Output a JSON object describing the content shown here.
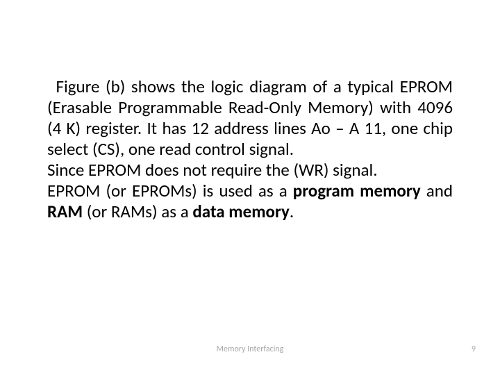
{
  "body": {
    "p1": " Figure (b) shows the logic diagram of a typical EPROM (Erasable Programmable Read-Only Memory) with 4096 (4 K) register. It has 12 address lines Ao – A 11, one chip select (CS), one read control signal.",
    "p2": "Since EPROM does not require the (WR) signal.",
    "p3a": "EPROM (or EPROMs) is used as a ",
    "p3b": "program memory",
    "p3c": " and ",
    "p3d": "RAM",
    "p3e": " (or RAMs) as a ",
    "p3f": "data memory",
    "p3g": "."
  },
  "footer": {
    "title": "Memory Interfacing",
    "page": "9"
  }
}
